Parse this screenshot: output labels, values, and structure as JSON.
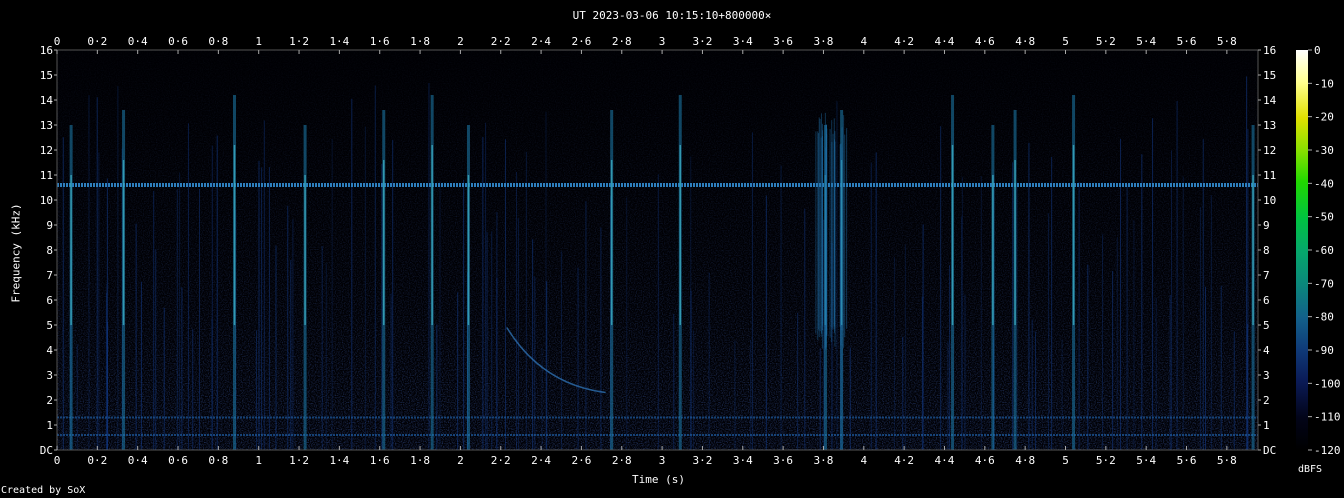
{
  "title": "UT 2023-03-06 10:15:10+800000×",
  "credit": "Created by SoX",
  "chart_data": {
    "type": "heatmap",
    "title": "UT 2023-03-06 10:15:10+800000×",
    "xlabel": "Time (s)",
    "ylabel": "Frequency (kHz)",
    "xlim": [
      0,
      5.98
    ],
    "ylim": [
      0,
      16
    ],
    "x_ticks": [
      "0",
      "0·2",
      "0·4",
      "0·6",
      "0·8",
      "1",
      "1·2",
      "1·4",
      "1·6",
      "1·8",
      "2",
      "2·2",
      "2·4",
      "2·6",
      "2·8",
      "3",
      "3·2",
      "3·4",
      "3·6",
      "3·8",
      "4",
      "4·2",
      "4·4",
      "4·6",
      "4·8",
      "5",
      "5·2",
      "5·4",
      "5·6",
      "5·8"
    ],
    "x_tick_values": [
      0,
      0.2,
      0.4,
      0.6,
      0.8,
      1,
      1.2,
      1.4,
      1.6,
      1.8,
      2,
      2.2,
      2.4,
      2.6,
      2.8,
      3,
      3.2,
      3.4,
      3.6,
      3.8,
      4,
      4.2,
      4.4,
      4.6,
      4.8,
      5,
      5.2,
      5.4,
      5.6,
      5.8
    ],
    "y_ticks": [
      "DC",
      "1",
      "2",
      "3",
      "4",
      "5",
      "6",
      "7",
      "8",
      "9",
      "10",
      "11",
      "12",
      "13",
      "14",
      "15",
      "16"
    ],
    "y_tick_values": [
      0,
      1,
      2,
      3,
      4,
      5,
      6,
      7,
      8,
      9,
      10,
      11,
      12,
      13,
      14,
      15,
      16
    ],
    "colorbar": {
      "label": "dBFS",
      "ticks": [
        "0",
        "-10",
        "-20",
        "-30",
        "-40",
        "-50",
        "-60",
        "-70",
        "-80",
        "-90",
        "-100",
        "-110",
        "-120"
      ],
      "tick_values": [
        0,
        -10,
        -20,
        -30,
        -40,
        -50,
        -60,
        -70,
        -80,
        -90,
        -100,
        -110,
        -120
      ],
      "range": [
        -120,
        0
      ]
    },
    "features": {
      "tone_lines_khz": [
        10.6,
        1.3,
        0.6
      ],
      "impulses_s": [
        0.07,
        0.33,
        0.88,
        1.23,
        1.62,
        1.86,
        2.04,
        2.75,
        3.09,
        3.81,
        3.89,
        4.44,
        4.64,
        4.75,
        5.04,
        5.93
      ],
      "sweep": {
        "start_s": 2.23,
        "start_khz": 4.9,
        "end_s": 2.72,
        "end_khz": 2.3
      }
    }
  }
}
